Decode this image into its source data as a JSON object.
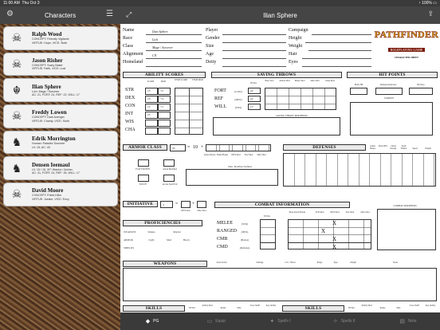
{
  "status": {
    "time": "11:00 AM",
    "date": "Thu Oct 3",
    "battery": "100%"
  },
  "left": {
    "title": "Characters",
    "characters": [
      {
        "name": "Ralph Wood",
        "lines": [
          "CONCEPT: Friendly Vigilante",
          "VIRTUE: Hope, VICE: Sloth"
        ],
        "icon": "☠"
      },
      {
        "name": "Jason Risher",
        "lines": [
          "CONCEPT: Scary Baker",
          "VIRTUE: Faith, VICE: Lust"
        ],
        "icon": "☠"
      },
      {
        "name": "Ilian Sphere",
        "lines": [
          "Lich: Mage / Sorcerer",
          "AC: 21, FORT: 24, REF: 22, WILL: 17"
        ],
        "icon": "☬"
      },
      {
        "name": "Freddy Lowen",
        "lines": [
          "CONCEPT: Dark Avenger",
          "VIRTUE: Charity, VICE: Sloth"
        ],
        "icon": "☠"
      },
      {
        "name": "Edrik Morrington",
        "lines": [
          "Human: Paladin/ Sorcerer",
          "LV: 15, AC: 43"
        ],
        "icon": "♞"
      },
      {
        "name": "Densen Ieemaul",
        "lines": [
          "LV: 15 / 15, XP: Warrior / Archer,",
          "AC: 31, FORT: 24, REF: 35, WILL: 17"
        ],
        "icon": "♞"
      },
      {
        "name": "David Moore",
        "lines": [
          "CONCEPT: Priest Killer",
          "VIRTUE: Justice, VICE: Envy"
        ],
        "icon": "☠"
      }
    ]
  },
  "sheet": {
    "title": "Ilian Sphere",
    "logo": {
      "main": "PATHFINDER",
      "sub": "ROLEPLAYING GAME",
      "tag": "CHARACTER SHEET"
    },
    "identity": {
      "name_label": "Name",
      "name_value": "Ilian Sphere",
      "race_label": "Race",
      "race_value": "Lich",
      "class_label": "Class",
      "class_value": "Mage / Sorcerer",
      "align_label": "Alignment",
      "align_value": "CN",
      "home_label": "Homeland",
      "player_label": "Player",
      "gender_label": "Gender",
      "size_label": "Size",
      "age_label": "Age",
      "deity_label": "Deity",
      "campaign_label": "Campaign",
      "height_label": "Height",
      "weight_label": "Weight",
      "hair_label": "Hair",
      "eyes_label": "Eyes"
    },
    "ability": {
      "title": "ABILITY SCORES",
      "cols": [
        "SCORE",
        "MOD",
        "TEMP SCORE",
        "TEMP MOD"
      ],
      "rows": [
        {
          "name": "STR",
          "score": "13",
          "mod": "+2"
        },
        {
          "name": "DEX",
          "score": "19",
          "mod": "+4"
        },
        {
          "name": "CON",
          "score": "12",
          "mod": "+1"
        },
        {
          "name": "INT",
          "score": "25",
          "mod": ""
        },
        {
          "name": "WIS",
          "score": "",
          "mod": ""
        },
        {
          "name": "CHA",
          "score": "",
          "mod": ""
        }
      ]
    },
    "saves": {
      "title": "SAVING THROWS",
      "cols": [
        "TOTAL",
        "Base Save",
        "Ability Mod",
        "Magic Mod",
        "Misc Mod",
        "Temp Mod"
      ],
      "rows": [
        {
          "name": "FORT",
          "abil": "(CON)",
          "total": "24"
        },
        {
          "name": "REF",
          "abil": "(DEX)",
          "total": "22"
        },
        {
          "name": "WILL",
          "abil": "(WIS)",
          "total": "17"
        }
      ],
      "modifiers_label": "SAVING THROW MODIFIERS"
    },
    "hp": {
      "title": "HIT POINTS",
      "cols": [
        "MAX HP",
        "Damage Reduction",
        "Hit Dice"
      ],
      "current": "CURRENT"
    },
    "armor": {
      "title": "ARMOR CLASS",
      "total": "35",
      "base": "10",
      "parts": [
        "Armor Bonus",
        "Shield Bonus",
        "DEX Mod",
        "Size Mod",
        "Misc Mod"
      ],
      "flat": "FLAT FOOTED",
      "touch": "TOUCH",
      "attack": "Attack Modified",
      "spell": "Arcane Spell Fail",
      "misc_label": "Misc. Modifiers Defined"
    },
    "defenses": {
      "title": "DEFENSES",
      "cols": [
        "Armor Bonus",
        "Max DEX",
        "Check Penalty",
        "Spell Failure",
        "Speed",
        "Weight"
      ]
    },
    "initiative": {
      "title": "INITIATIVE",
      "total": "4",
      "parts": [
        "DEX Mod",
        "Misc Mod"
      ]
    },
    "combat": {
      "title": "COMBAT INFORMATION",
      "cols": [
        "TOTAL",
        "Base Attack Bonus",
        "STR Mod",
        "DEX Mod",
        "Size Mod",
        "Misc Mod"
      ],
      "rows": [
        {
          "name": "MELEE",
          "abil": "(STR)"
        },
        {
          "name": "RANGED",
          "abil": "(DEX)"
        },
        {
          "name": "CMB",
          "abil": "(Bonus)"
        },
        {
          "name": "CMD",
          "abil": "(Defense)"
        }
      ],
      "modifiers_label": "COMBAT MODIFIERS"
    },
    "prof": {
      "title": "PROFICIENCIES",
      "weapons_label": "WEAPONS",
      "weapons": [
        "Simple",
        "Martial"
      ],
      "armor_label": "ARMOR",
      "armor": [
        "Light",
        "Med",
        "Heavy"
      ],
      "shields_label": "SHIELDS"
    },
    "weapons": {
      "title": "WEAPONS",
      "cols": [
        "Total Attack",
        "Damage",
        "Crit / Threat",
        "Range",
        "Type",
        "Weight",
        "Notes"
      ]
    },
    "skills": {
      "title": "SKILLS",
      "cols": [
        "TOTAL",
        "Ability Mod",
        "Ranks",
        "Misc",
        "Class Skill?",
        "Key Ability"
      ],
      "left_row": {
        "name": "ACROBATICS",
        "key": "DEX"
      },
      "right_row": {
        "name": "KNOWLEDGE (LOCAL) *",
        "key": "INT"
      }
    }
  },
  "tabs": [
    {
      "label": "PG",
      "icon": "◆",
      "active": true
    },
    {
      "label": "Equip",
      "icon": "▭",
      "active": false
    },
    {
      "label": "Spells I",
      "icon": "✦",
      "active": false
    },
    {
      "label": "Spells II",
      "icon": "✧",
      "active": false
    },
    {
      "label": "Note",
      "icon": "▤",
      "active": false
    }
  ]
}
